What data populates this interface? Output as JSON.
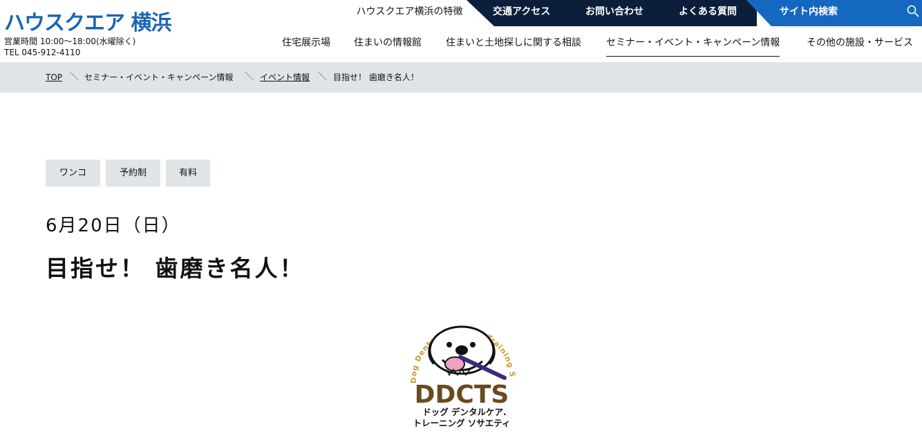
{
  "site": {
    "logo_text": "ハウスクエア 横浜",
    "hours_line": "営業時間 10:00〜18:00(水曜除く)",
    "tel_line": "TEL 045-912-4110"
  },
  "utility_nav": {
    "features": "ハウスクエア横浜の特徴",
    "access": "交通アクセス",
    "contact": "お問い合わせ",
    "faq": "よくある質問",
    "search": "サイト内検索"
  },
  "main_nav": [
    {
      "label": "住宅展示場"
    },
    {
      "label": "住まいの情報館"
    },
    {
      "label": "住まいと土地探しに関する相談"
    },
    {
      "label": "セミナー・イベント・キャンペーン情報"
    },
    {
      "label": "その他の施設・サービス"
    }
  ],
  "breadcrumb": [
    {
      "label": "TOP"
    },
    {
      "label": "セミナー・イベント・キャンペーン情報"
    },
    {
      "label": "イベント情報"
    },
    {
      "label": "目指せ！ 歯磨き名人！"
    }
  ],
  "tags": [
    {
      "label": "ワンコ"
    },
    {
      "label": "予約制"
    },
    {
      "label": "有料"
    }
  ],
  "event": {
    "date": "6月20日（日）",
    "title": "目指せ！ 歯磨き名人！"
  },
  "ddcts_logo": {
    "arc_text": "Dog Dental Care and Training Society",
    "acronym": "DDCTS",
    "caption_line1": "ドッグ デンタルケア.",
    "caption_line2": "トレーニング ソサエティ"
  },
  "colors": {
    "brand_blue": "#1a64b4",
    "util_dark": "#0b1f3b",
    "search_blue": "#1568c0",
    "breadcrumb_bg": "#e1e4e6",
    "logo_brown": "#6b4a1e",
    "logo_gold": "#c89a2e"
  }
}
